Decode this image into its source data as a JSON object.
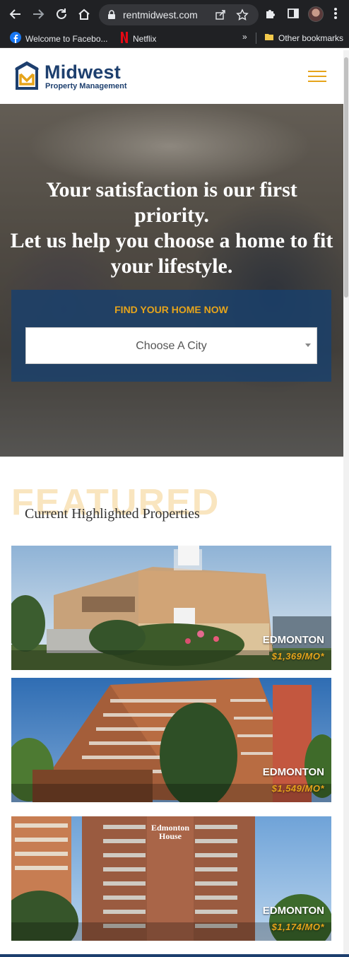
{
  "browser": {
    "url": "rentmidwest.com",
    "bookmarks": [
      {
        "label": "Welcome to Facebo...",
        "icon": "facebook-icon"
      },
      {
        "label": "Netflix",
        "icon": "netflix-icon"
      }
    ],
    "overflow_label": "»",
    "other_bookmarks": "Other bookmarks"
  },
  "header": {
    "logo_name": "Midwest",
    "logo_sub": "Property Management"
  },
  "hero": {
    "headline_lines": [
      "Your satisfaction is our first priority.",
      "Let us help you choose a home to fit",
      "your lifestyle."
    ],
    "finder_title": "FIND YOUR HOME NOW",
    "city_select": "Choose A City"
  },
  "featured": {
    "bg_word": "FEATURED",
    "subtitle": "Current Highlighted Properties",
    "properties": [
      {
        "city": "EDMONTON",
        "price": "$1,369/MO*"
      },
      {
        "city": "EDMONTON",
        "price": "$1,549/MO*"
      },
      {
        "city": "EDMONTON",
        "price": "$1,174/MO*",
        "sign": "Edmonton House"
      }
    ]
  },
  "colors": {
    "brand_blue": "#1d3f6e",
    "accent_gold": "#e6a41b",
    "chrome_dark": "#202124"
  }
}
